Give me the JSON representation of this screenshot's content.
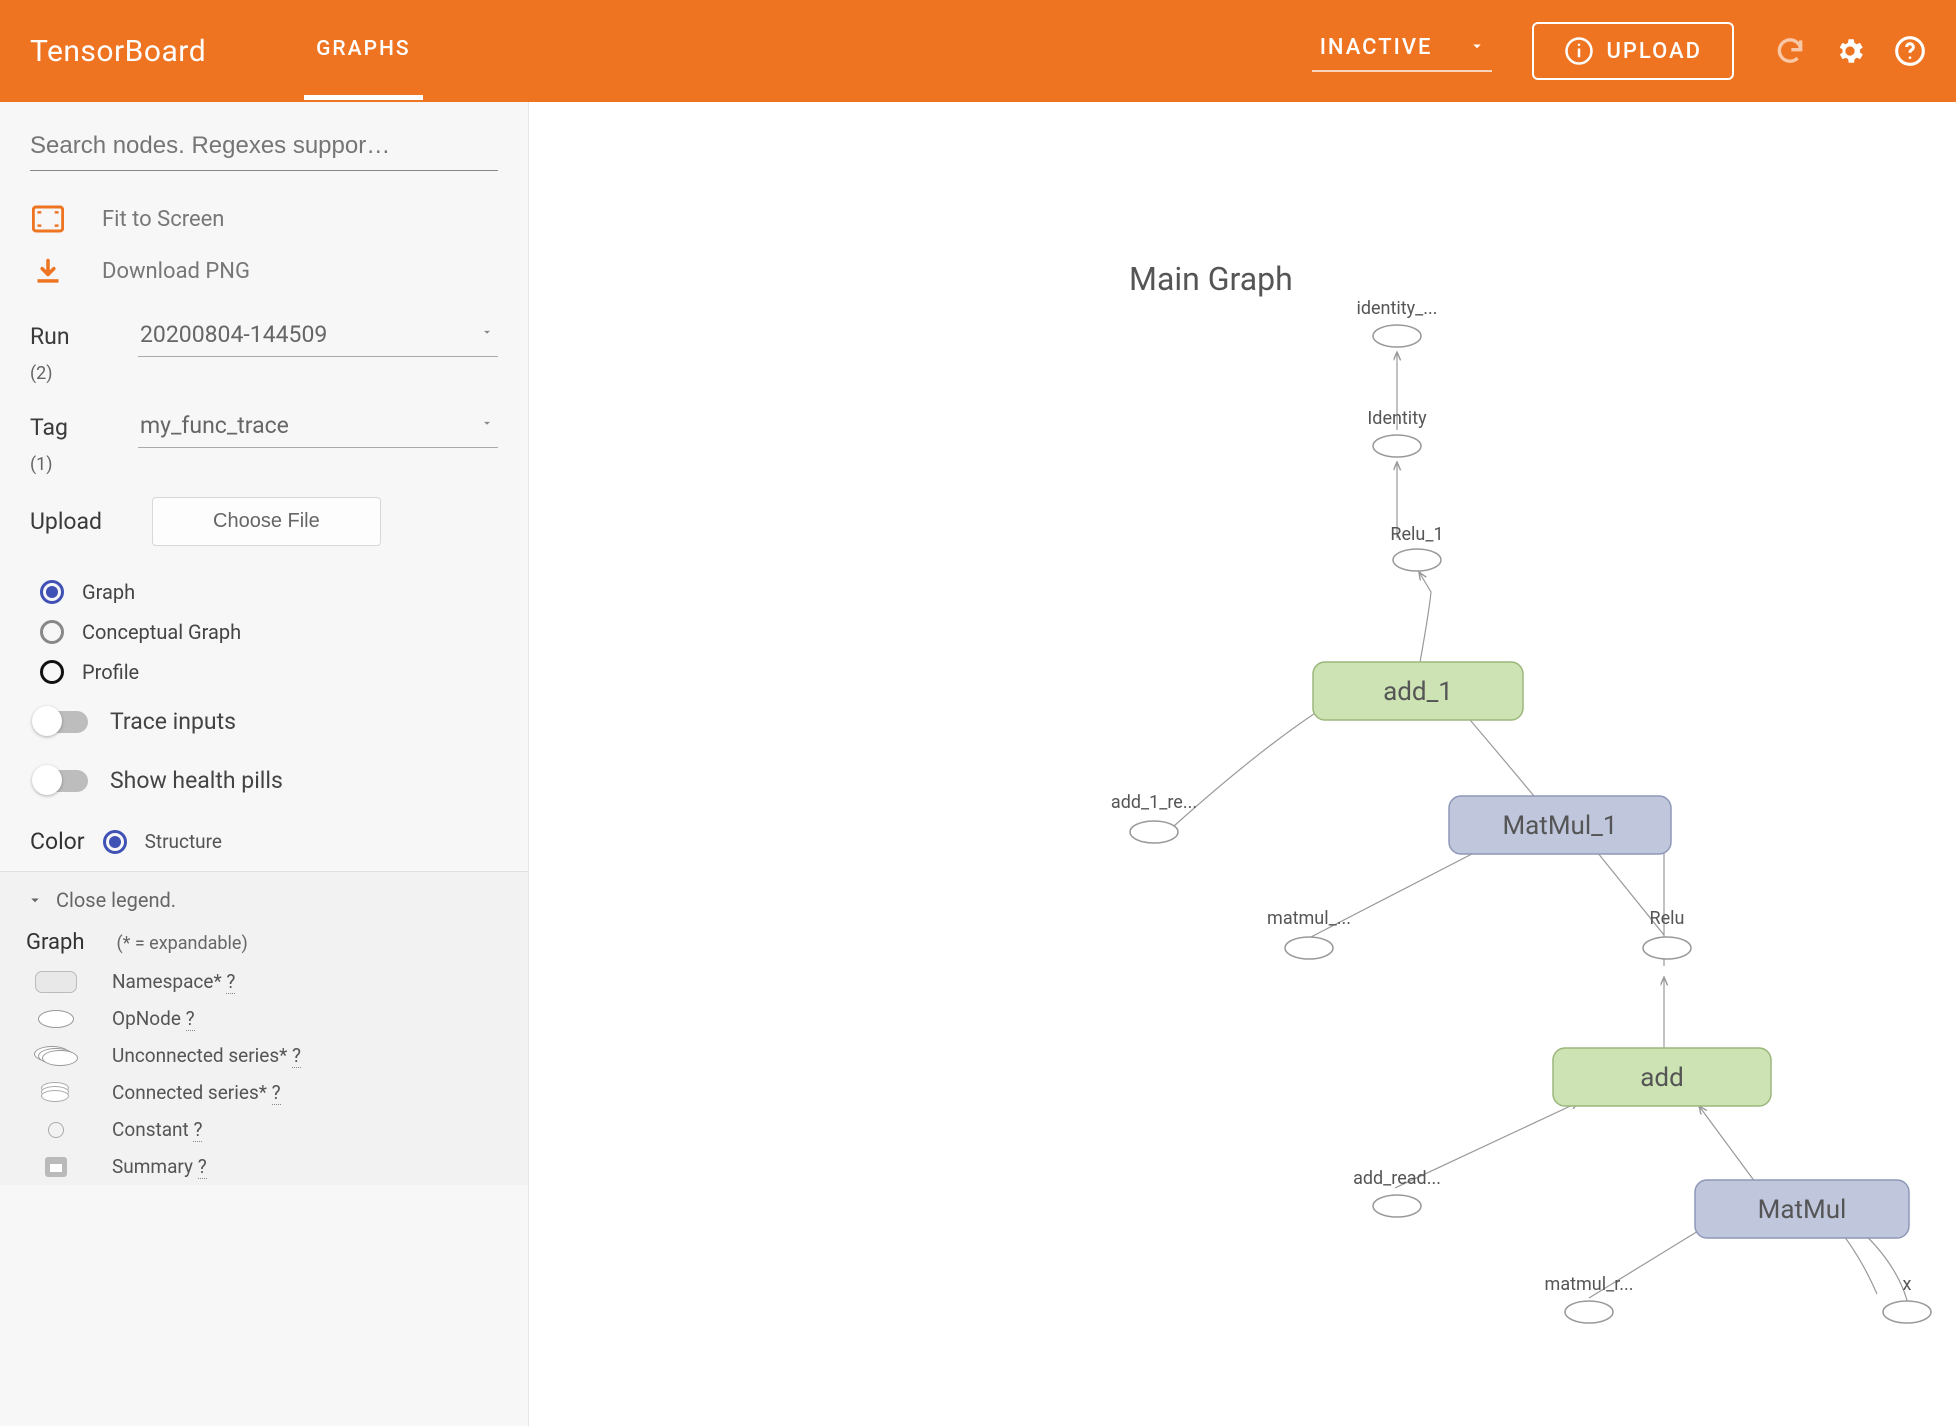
{
  "header": {
    "brand": "TensorBoard",
    "tab_graphs": "GRAPHS",
    "inactive_label": "INACTIVE",
    "upload_label": "UPLOAD"
  },
  "sidebar": {
    "search_placeholder": "Search nodes. Regexes suppor…",
    "fit_label": "Fit to Screen",
    "download_label": "Download PNG",
    "run_label": "Run",
    "run_count": "(2)",
    "run_value": "20200804-144509",
    "tag_label": "Tag",
    "tag_count": "(1)",
    "tag_value": "my_func_trace",
    "upload_label": "Upload",
    "choose_file": "Choose File",
    "radio_graph": "Graph",
    "radio_conceptual": "Conceptual Graph",
    "radio_profile": "Profile",
    "toggle_trace": "Trace inputs",
    "toggle_health": "Show health pills",
    "color_label": "Color",
    "color_value": "Structure"
  },
  "legend": {
    "close": "Close legend.",
    "title": "Graph",
    "note": "(* = expandable)",
    "namespace": "Namespace* ",
    "opnode": "OpNode ",
    "unconnected": "Unconnected series* ",
    "connected": "Connected series* ",
    "constant": "Constant ",
    "summary": "Summary ",
    "q": "?"
  },
  "graph": {
    "title": "Main Graph",
    "nodes": {
      "identity_top": "identity_...",
      "identity": "Identity",
      "relu_1": "Relu_1",
      "add_1": "add_1",
      "add_1_re": "add_1_re...",
      "matmul_1": "MatMul_1",
      "matmul_dots": "matmul_...",
      "relu": "Relu",
      "add": "add",
      "add_read": "add_read...",
      "matmul": "MatMul",
      "matmul_r": "matmul_r...",
      "x": "x"
    }
  }
}
